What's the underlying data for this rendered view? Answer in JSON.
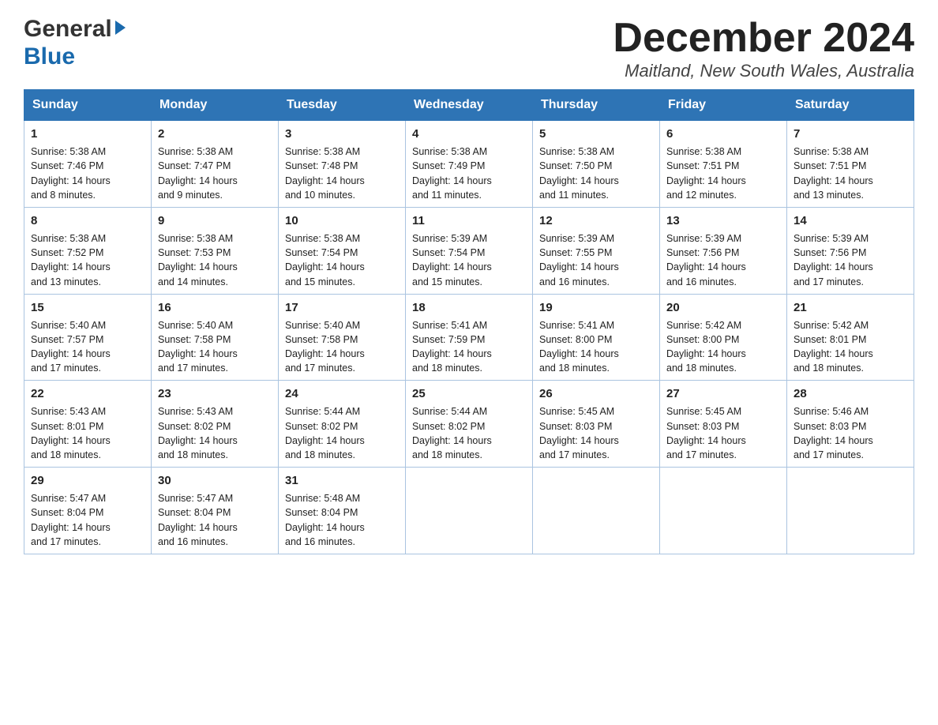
{
  "header": {
    "logo_line1": "General",
    "logo_line2": "Blue",
    "month_title": "December 2024",
    "location": "Maitland, New South Wales, Australia"
  },
  "columns": [
    "Sunday",
    "Monday",
    "Tuesday",
    "Wednesday",
    "Thursday",
    "Friday",
    "Saturday"
  ],
  "weeks": [
    [
      {
        "day": "1",
        "sunrise": "5:38 AM",
        "sunset": "7:46 PM",
        "daylight": "14 hours and 8 minutes."
      },
      {
        "day": "2",
        "sunrise": "5:38 AM",
        "sunset": "7:47 PM",
        "daylight": "14 hours and 9 minutes."
      },
      {
        "day": "3",
        "sunrise": "5:38 AM",
        "sunset": "7:48 PM",
        "daylight": "14 hours and 10 minutes."
      },
      {
        "day": "4",
        "sunrise": "5:38 AM",
        "sunset": "7:49 PM",
        "daylight": "14 hours and 11 minutes."
      },
      {
        "day": "5",
        "sunrise": "5:38 AM",
        "sunset": "7:50 PM",
        "daylight": "14 hours and 11 minutes."
      },
      {
        "day": "6",
        "sunrise": "5:38 AM",
        "sunset": "7:51 PM",
        "daylight": "14 hours and 12 minutes."
      },
      {
        "day": "7",
        "sunrise": "5:38 AM",
        "sunset": "7:51 PM",
        "daylight": "14 hours and 13 minutes."
      }
    ],
    [
      {
        "day": "8",
        "sunrise": "5:38 AM",
        "sunset": "7:52 PM",
        "daylight": "14 hours and 13 minutes."
      },
      {
        "day": "9",
        "sunrise": "5:38 AM",
        "sunset": "7:53 PM",
        "daylight": "14 hours and 14 minutes."
      },
      {
        "day": "10",
        "sunrise": "5:38 AM",
        "sunset": "7:54 PM",
        "daylight": "14 hours and 15 minutes."
      },
      {
        "day": "11",
        "sunrise": "5:39 AM",
        "sunset": "7:54 PM",
        "daylight": "14 hours and 15 minutes."
      },
      {
        "day": "12",
        "sunrise": "5:39 AM",
        "sunset": "7:55 PM",
        "daylight": "14 hours and 16 minutes."
      },
      {
        "day": "13",
        "sunrise": "5:39 AM",
        "sunset": "7:56 PM",
        "daylight": "14 hours and 16 minutes."
      },
      {
        "day": "14",
        "sunrise": "5:39 AM",
        "sunset": "7:56 PM",
        "daylight": "14 hours and 17 minutes."
      }
    ],
    [
      {
        "day": "15",
        "sunrise": "5:40 AM",
        "sunset": "7:57 PM",
        "daylight": "14 hours and 17 minutes."
      },
      {
        "day": "16",
        "sunrise": "5:40 AM",
        "sunset": "7:58 PM",
        "daylight": "14 hours and 17 minutes."
      },
      {
        "day": "17",
        "sunrise": "5:40 AM",
        "sunset": "7:58 PM",
        "daylight": "14 hours and 17 minutes."
      },
      {
        "day": "18",
        "sunrise": "5:41 AM",
        "sunset": "7:59 PM",
        "daylight": "14 hours and 18 minutes."
      },
      {
        "day": "19",
        "sunrise": "5:41 AM",
        "sunset": "8:00 PM",
        "daylight": "14 hours and 18 minutes."
      },
      {
        "day": "20",
        "sunrise": "5:42 AM",
        "sunset": "8:00 PM",
        "daylight": "14 hours and 18 minutes."
      },
      {
        "day": "21",
        "sunrise": "5:42 AM",
        "sunset": "8:01 PM",
        "daylight": "14 hours and 18 minutes."
      }
    ],
    [
      {
        "day": "22",
        "sunrise": "5:43 AM",
        "sunset": "8:01 PM",
        "daylight": "14 hours and 18 minutes."
      },
      {
        "day": "23",
        "sunrise": "5:43 AM",
        "sunset": "8:02 PM",
        "daylight": "14 hours and 18 minutes."
      },
      {
        "day": "24",
        "sunrise": "5:44 AM",
        "sunset": "8:02 PM",
        "daylight": "14 hours and 18 minutes."
      },
      {
        "day": "25",
        "sunrise": "5:44 AM",
        "sunset": "8:02 PM",
        "daylight": "14 hours and 18 minutes."
      },
      {
        "day": "26",
        "sunrise": "5:45 AM",
        "sunset": "8:03 PM",
        "daylight": "14 hours and 17 minutes."
      },
      {
        "day": "27",
        "sunrise": "5:45 AM",
        "sunset": "8:03 PM",
        "daylight": "14 hours and 17 minutes."
      },
      {
        "day": "28",
        "sunrise": "5:46 AM",
        "sunset": "8:03 PM",
        "daylight": "14 hours and 17 minutes."
      }
    ],
    [
      {
        "day": "29",
        "sunrise": "5:47 AM",
        "sunset": "8:04 PM",
        "daylight": "14 hours and 17 minutes."
      },
      {
        "day": "30",
        "sunrise": "5:47 AM",
        "sunset": "8:04 PM",
        "daylight": "14 hours and 16 minutes."
      },
      {
        "day": "31",
        "sunrise": "5:48 AM",
        "sunset": "8:04 PM",
        "daylight": "14 hours and 16 minutes."
      },
      null,
      null,
      null,
      null
    ]
  ],
  "labels": {
    "sunrise": "Sunrise:",
    "sunset": "Sunset:",
    "daylight": "Daylight:"
  }
}
